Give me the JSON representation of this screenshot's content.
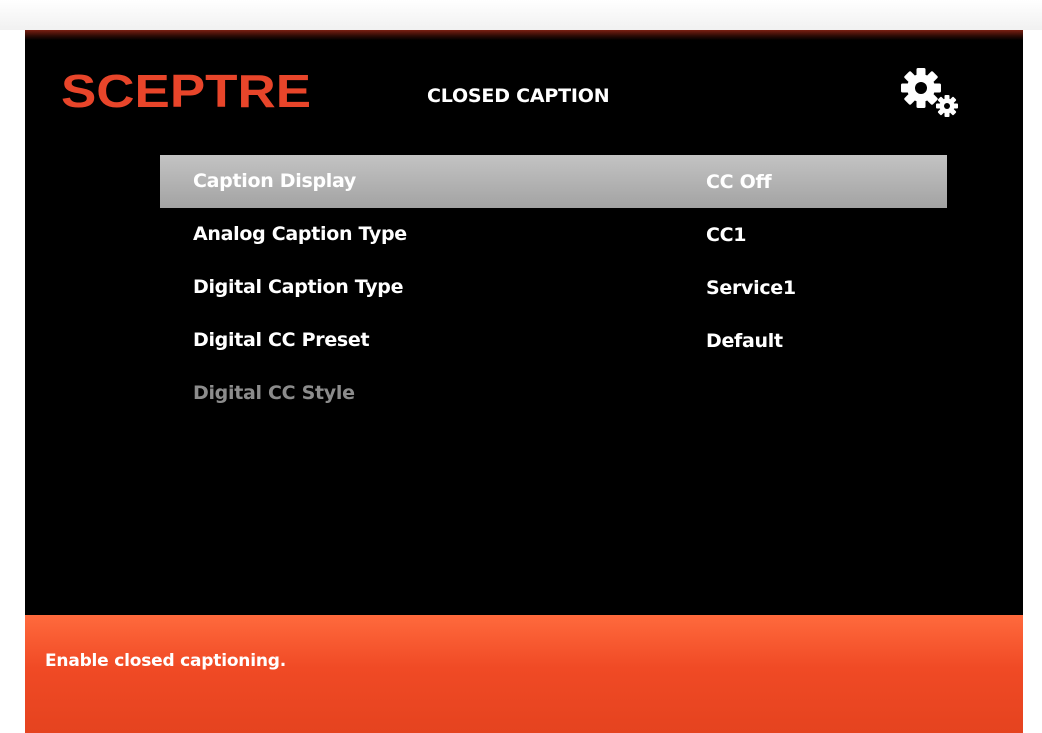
{
  "header": {
    "brand": "SCEPTRE",
    "title": "CLOSED CAPTION",
    "settings_icon": "gears-icon"
  },
  "menu": {
    "items": [
      {
        "label": "Caption Display",
        "value": "CC Off",
        "state": "selected"
      },
      {
        "label": "Analog Caption Type",
        "value": "CC1",
        "state": "normal"
      },
      {
        "label": "Digital Caption Type",
        "value": "Service1",
        "state": "normal"
      },
      {
        "label": "Digital CC Preset",
        "value": "Default",
        "state": "normal"
      },
      {
        "label": "Digital CC Style",
        "value": "",
        "state": "disabled"
      }
    ]
  },
  "help": {
    "text": "Enable closed captioning."
  },
  "colors": {
    "brand": "#e8452a",
    "help_bar": "#f04a25",
    "selected_row": "#b3b3b3",
    "disabled_text": "#8c8c8c"
  }
}
